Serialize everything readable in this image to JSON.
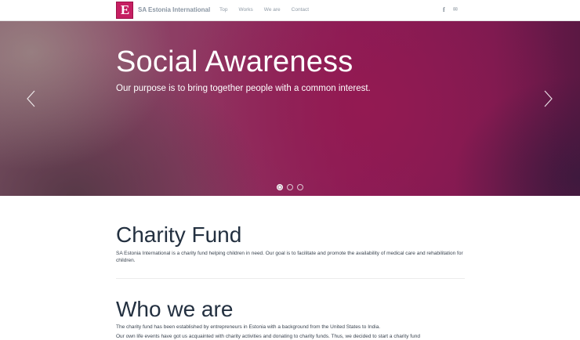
{
  "header": {
    "logo_text": "E",
    "brand": "SA Estonia International",
    "nav": [
      "Top",
      "Works",
      "We are",
      "Contact"
    ],
    "social": {
      "facebook_glyph": "f",
      "mail_glyph": "✉"
    }
  },
  "hero": {
    "title": "Social Awareness",
    "subtitle": "Our purpose is to bring together people with a common interest.",
    "slide_count": 3,
    "active_slide": 1
  },
  "charity": {
    "heading": "Charity Fund",
    "text": "SA Estonia International is a charity fund helping children in need. Our goal is to facilitate and promote the availability of medical care and rehabilitation for children."
  },
  "who": {
    "heading": "Who we are",
    "line1": "The charity fund has been established by entrepreneurs in Estonia with a background from the United States to India.",
    "line2": "Our own life events have got us acquainted with charity activities and donating to charity funds. Thus, we decided to start a charity fund"
  },
  "colors": {
    "accent": "#c61f62",
    "hero_mid": "#8a1d58"
  }
}
